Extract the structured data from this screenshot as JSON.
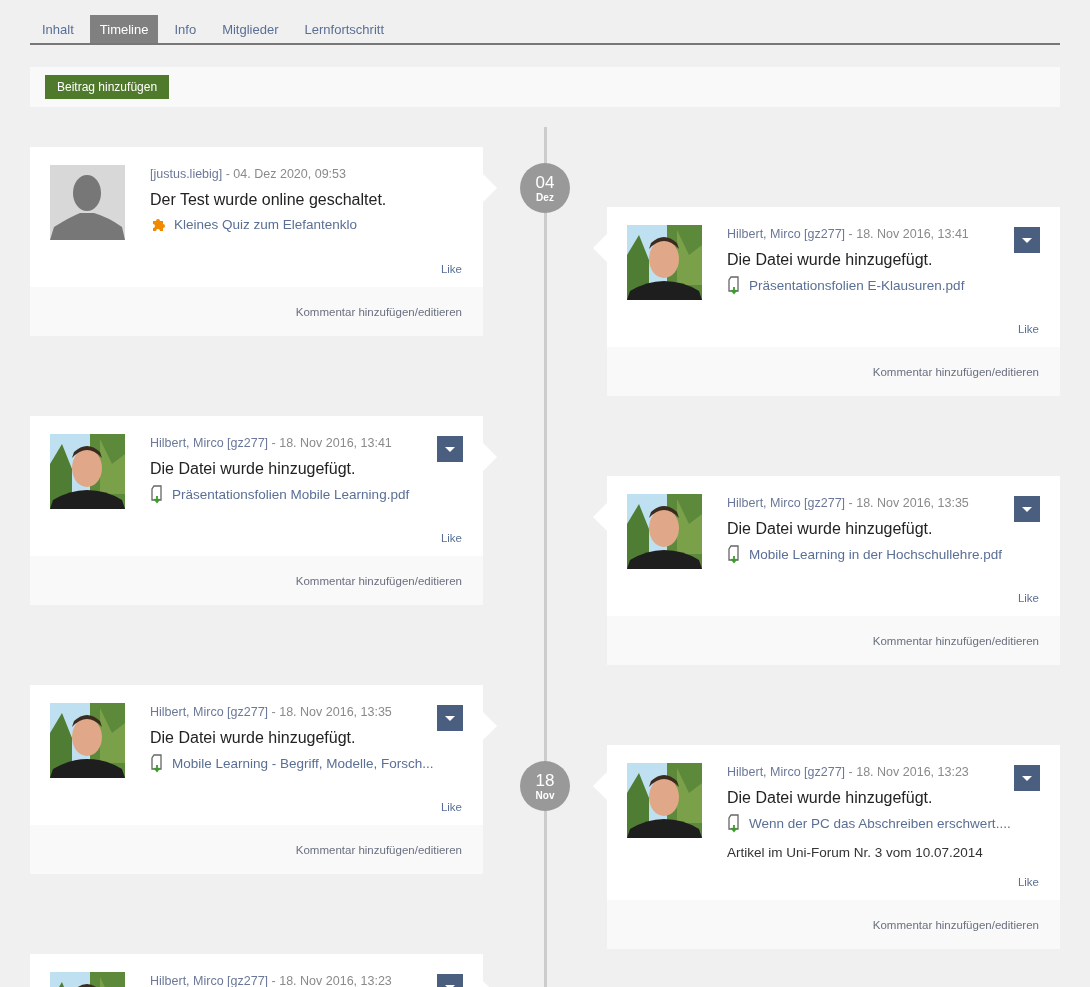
{
  "tabs": [
    {
      "label": "Inhalt",
      "selected": false
    },
    {
      "label": "Timeline",
      "selected": true
    },
    {
      "label": "Info",
      "selected": false
    },
    {
      "label": "Mitglieder",
      "selected": false
    },
    {
      "label": "Lernfortschritt",
      "selected": false
    }
  ],
  "toolbar": {
    "button": "Beitrag hinzufügen"
  },
  "timeline": {
    "left": [
      {
        "avatar": {
          "kind": "silhouette"
        },
        "author": "[justus.liebig]",
        "date": " - 04. Dez 2020, 09:53",
        "menu": false,
        "title": "Der Test wurde online geschaltet.",
        "attachment": {
          "kind": "quiz",
          "label": "Kleines Quiz zum Elefantenklo"
        },
        "like": "Like",
        "comment": "Kommentar hinzufügen/editieren",
        "marker": {
          "day": "04",
          "month": "Dez"
        }
      },
      {
        "author": "Hilbert, Mirco [gz277]",
        "date": " - 18. Nov 2016, 13:41",
        "menu": true,
        "title": "Die Datei wurde hinzugefügt.",
        "attachment": {
          "kind": "file",
          "label": "Präsentationsfolien Mobile Learning.pdf"
        },
        "like": "Like",
        "comment": "Kommentar hinzufügen/editieren"
      },
      {
        "author": "Hilbert, Mirco [gz277]",
        "date": " - 18. Nov 2016, 13:35",
        "menu": true,
        "title": "Die Datei wurde hinzugefügt.",
        "attachment": {
          "kind": "file",
          "label": "Mobile Learning - Begriff, Modelle, Forsch..."
        },
        "like": "Like",
        "comment": "Kommentar hinzufügen/editieren"
      },
      {
        "author": "Hilbert, Mirco [gz277]",
        "date": " - 18. Nov 2016, 13:23",
        "menu": true
      }
    ],
    "right": [
      {
        "author": "Hilbert, Mirco [gz277]",
        "date": " - 18. Nov 2016, 13:41",
        "menu": true,
        "title": "Die Datei wurde hinzugefügt.",
        "attachment": {
          "kind": "file",
          "label": "Präsentationsfolien E-Klausuren.pdf"
        },
        "like": "Like",
        "comment": "Kommentar hinzufügen/editieren"
      },
      {
        "author": "Hilbert, Mirco [gz277]",
        "date": " - 18. Nov 2016, 13:35",
        "menu": true,
        "title": "Die Datei wurde hinzugefügt.",
        "attachment": {
          "kind": "file",
          "label": "Mobile Learning in der Hochschullehre.pdf"
        },
        "like": "Like",
        "comment": "Kommentar hinzufügen/editieren"
      },
      {
        "author": "Hilbert, Mirco [gz277]",
        "date": " - 18. Nov 2016, 13:23",
        "menu": true,
        "title": "Die Datei wurde hinzugefügt.",
        "attachment": {
          "kind": "file",
          "label": "Wenn der PC das Abschreiben erschwert...."
        },
        "description": "Artikel im Uni-Forum Nr. 3 vom 10.07.2014",
        "like": "Like",
        "comment": "Kommentar hinzufügen/editieren",
        "marker": {
          "day": "18",
          "month": "Nov"
        }
      }
    ]
  }
}
